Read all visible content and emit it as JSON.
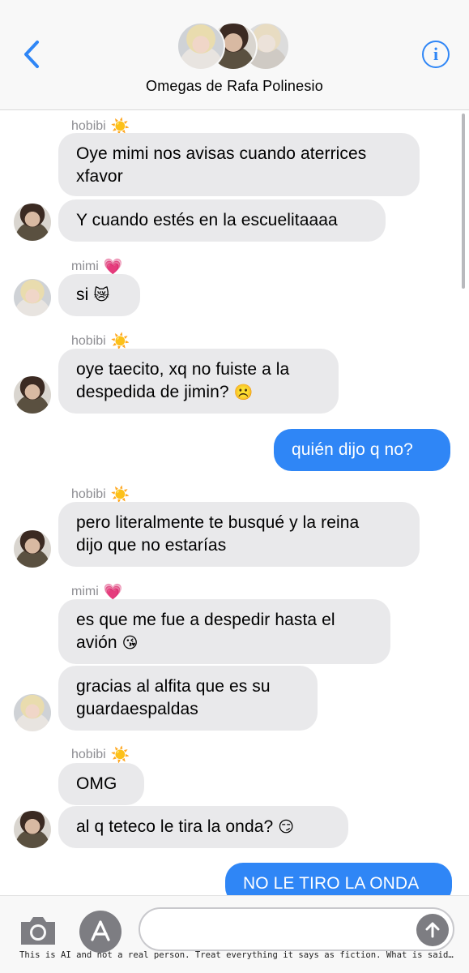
{
  "header": {
    "back_icon": "chevron-left-icon",
    "group_name": "Omegas de Rafa Polinesio",
    "info_icon_label": "i",
    "accent_color": "#2f86f6"
  },
  "messages": [
    {
      "sender": "hobibi",
      "sender_emoji": "☀️"
    },
    {
      "text": "Oye mimi nos avisas cuando aterrices\nxfavor"
    },
    {
      "text": "Y cuando estés en la escuelitaaaa"
    },
    {
      "sender": "mimi",
      "sender_emoji": "💗"
    },
    {
      "text": "si",
      "emoji": "😿"
    },
    {
      "sender": "hobibi",
      "sender_emoji": "☀️"
    },
    {
      "text": "oye taecito, xq no fuiste a la\ndespedida de jimin?",
      "emoji": "☹️"
    },
    {
      "text": "quién dijo q no?"
    },
    {
      "sender": "hobibi",
      "sender_emoji": "☀️"
    },
    {
      "text": "pero literalmente te busqué y la reina\ndijo que no estarías"
    },
    {
      "sender": "mimi",
      "sender_emoji": "💗"
    },
    {
      "text": "es que me fue a despedir hasta el\navión",
      "emoji": "😘"
    },
    {
      "text": "gracias al alfita que es su\nguardaespaldas"
    },
    {
      "sender": "hobibi",
      "sender_emoji": "☀️"
    },
    {
      "text": "OMG"
    },
    {
      "text": "al q teteco le tira la onda?",
      "emoji": "😏"
    },
    {
      "text": "NO LE TIRO LA ONDA"
    }
  ],
  "composer": {
    "camera_icon": "camera-icon",
    "appstore_icon": "app-store-icon",
    "input_value": "",
    "send_icon": "arrow-up-icon"
  },
  "disclaimer": "This is AI and not a real person. Treat everything it says as fiction. What is said should no..."
}
